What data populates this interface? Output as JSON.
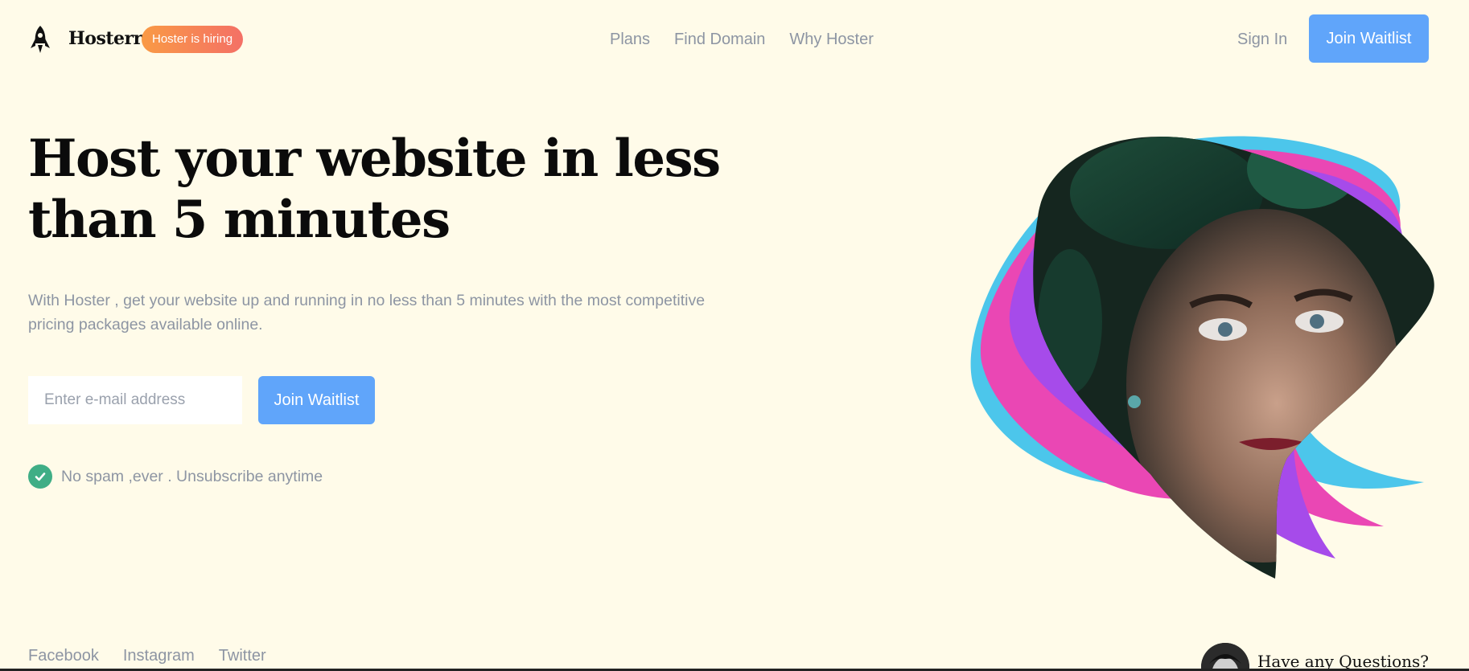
{
  "brand": {
    "name": "Hosterr",
    "hiring_badge": "Hoster is hiring",
    "logo_icon": "rocket-icon"
  },
  "nav": {
    "links": [
      "Plans",
      "Find Domain",
      "Why Hoster"
    ],
    "sign_in": "Sign In",
    "cta": "Join Waitlist"
  },
  "hero": {
    "title": "Host your website in less than 5 minutes",
    "subtitle": "With Hoster , get your website up and running in no less than 5 minutes with the most competitive pricing packages available online.",
    "email_placeholder": "Enter e-mail address",
    "cta": "Join Waitlist",
    "note": "No spam ,ever . Unsubscribe anytime",
    "note_icon": "check-circle-icon"
  },
  "footer": {
    "links": [
      "Facebook",
      "Instagram",
      "Twitter"
    ],
    "help_text": "Have any Questions?"
  },
  "colors": {
    "background": "#fffbe9",
    "primary": "#60a5fa",
    "muted_text": "#8d95a3",
    "badge_start": "#f99a45",
    "badge_end": "#f47066",
    "check": "#3fae86",
    "art_cyan": "#4cc6eb",
    "art_pink": "#ea47b4",
    "art_purple": "#a64bea"
  }
}
